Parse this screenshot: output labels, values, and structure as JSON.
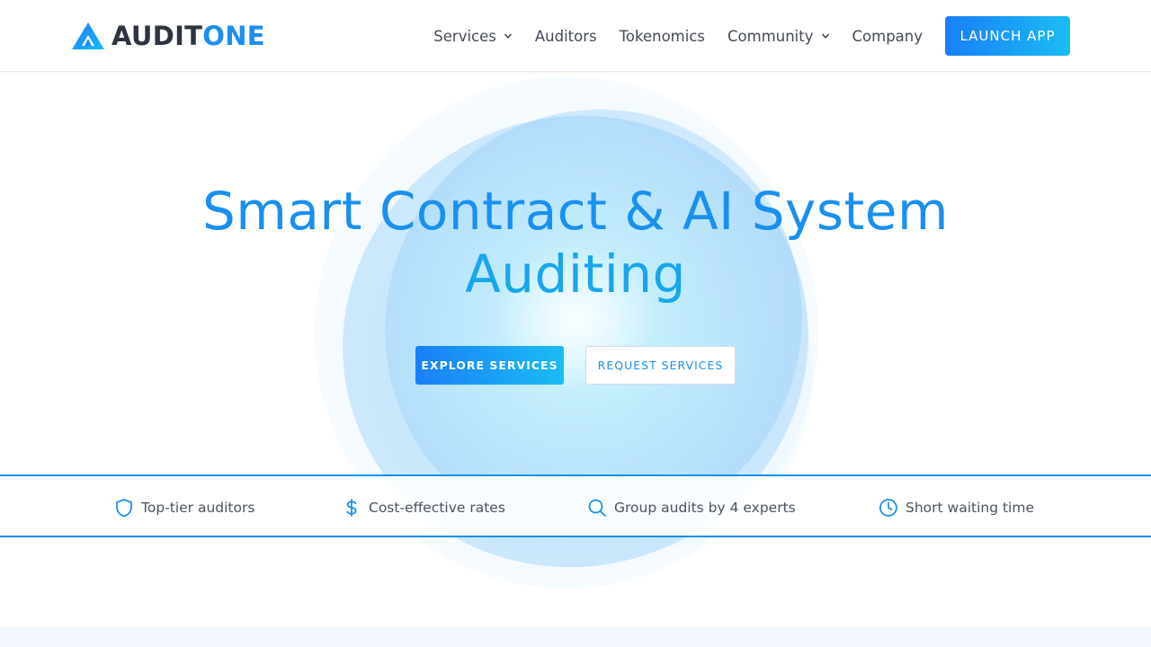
{
  "brand": {
    "name_part1": "AUDIT",
    "name_part2": "ONE",
    "logo_icon": "auditone-logo-icon",
    "primary_color": "#1a8ff0",
    "dark_color": "#2d3440"
  },
  "nav": {
    "items": [
      {
        "label": "Services",
        "has_dropdown": true
      },
      {
        "label": "Auditors",
        "has_dropdown": false
      },
      {
        "label": "Tokenomics",
        "has_dropdown": false
      },
      {
        "label": "Community",
        "has_dropdown": true
      },
      {
        "label": "Company",
        "has_dropdown": false
      }
    ],
    "launch_label": "LAUNCH APP"
  },
  "hero": {
    "title_line1": "Smart Contract & AI System",
    "title_line2": "Auditing",
    "primary_button": "EXPLORE SERVICES",
    "secondary_button": "REQUEST SERVICES"
  },
  "features": [
    {
      "label": "Top-tier auditors",
      "icon": "shield-icon"
    },
    {
      "label": "Cost-effective rates",
      "icon": "dollar-icon"
    },
    {
      "label": "Group audits by 4 experts",
      "icon": "search-icon"
    },
    {
      "label": "Short waiting time",
      "icon": "clock-icon"
    }
  ]
}
